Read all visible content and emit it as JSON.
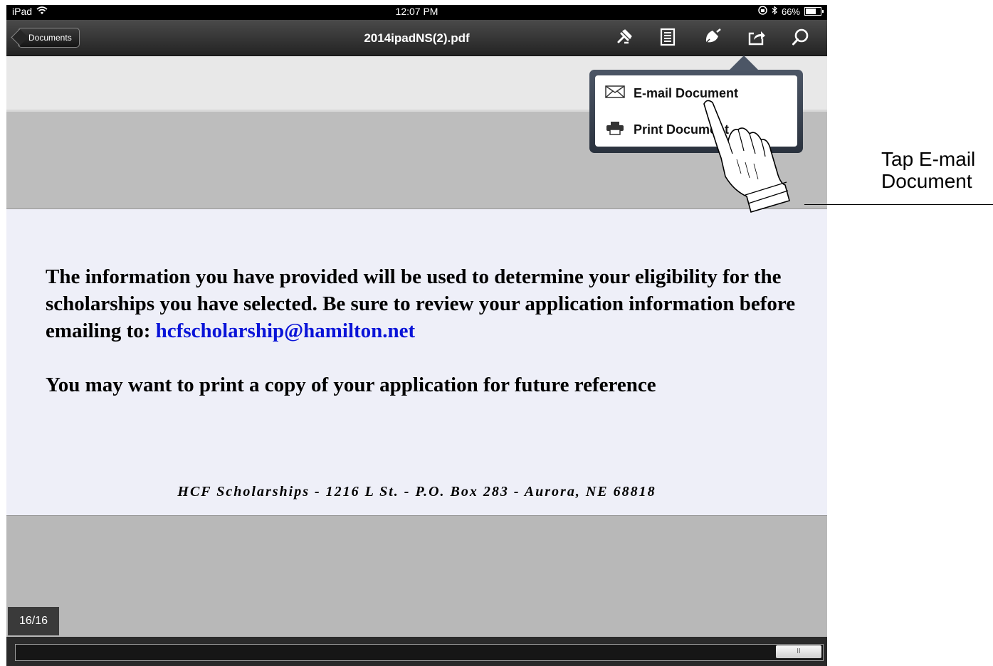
{
  "status_bar": {
    "device": "iPad",
    "time": "12:07 PM",
    "battery": "66%"
  },
  "toolbar": {
    "back_label": "Documents",
    "title": "2014ipadNS(2).pdf",
    "tools": [
      "annotate-tool-icon",
      "thumbnails-icon",
      "sign-icon",
      "share-icon",
      "search-icon"
    ]
  },
  "share_menu": {
    "items": [
      {
        "label": "E-mail Document",
        "icon": "envelope-icon"
      },
      {
        "label": "Print Document",
        "icon": "printer-icon"
      }
    ]
  },
  "document": {
    "paragraph_1": "The information you have provided will be used to determine your eligibility for the scholarships you have selected. Be sure to review your application information before emailing to:",
    "email": "hcfscholarship@hamilton.net",
    "paragraph_2": "You may want to print a copy of your application for future reference",
    "footer": "HCF Scholarships - 1216 L St. - P.O. Box 283 - Aurora, NE 68818"
  },
  "page_indicator": "16/16",
  "scrubber_thumb_label": "II",
  "callout": {
    "line1": "Tap E-mail",
    "line2": "Document"
  },
  "colors": {
    "toolbar": "#2a2a2a",
    "link": "#0a14d8",
    "popover_frame": "#3a4350",
    "page_background": "#eeeff8"
  }
}
